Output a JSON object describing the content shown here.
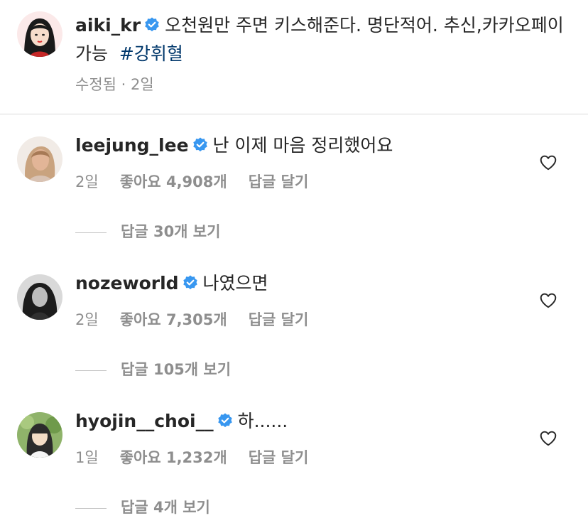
{
  "post_caption": {
    "username": "aiki_kr",
    "text": "오천원만 주면 키스해준다. 명단적어. 추신,카카오페이가능",
    "hashtag": "#강휘혈",
    "edited_label": "수정됨 · 2일"
  },
  "comments": [
    {
      "username": "leejung_lee",
      "text": "난 이제 마음 정리했어요",
      "time": "2일",
      "likes": "좋아요 4,908개",
      "reply_label": "답글 달기",
      "view_replies": "답글 30개 보기",
      "avatar_color": "#e7d2c3"
    },
    {
      "username": "nozeworld",
      "text": "나였으면",
      "time": "2일",
      "likes": "좋아요 7,305개",
      "reply_label": "답글 달기",
      "view_replies": "답글 105개 보기",
      "avatar_color": "#2a2a2a"
    },
    {
      "username": "hyojin__choi__",
      "text": "하......",
      "time": "1일",
      "likes": "좋아요 1,232개",
      "reply_label": "답글 달기",
      "view_replies": "답글 4개 보기",
      "avatar_color": "#6f8f4e"
    }
  ],
  "colors": {
    "verified_badge": "#3897f0",
    "hashtag": "#00376b",
    "secondary_text": "#8e8e8e"
  },
  "icons": {
    "verified": "verified-badge-icon",
    "like": "heart-outline-icon"
  }
}
